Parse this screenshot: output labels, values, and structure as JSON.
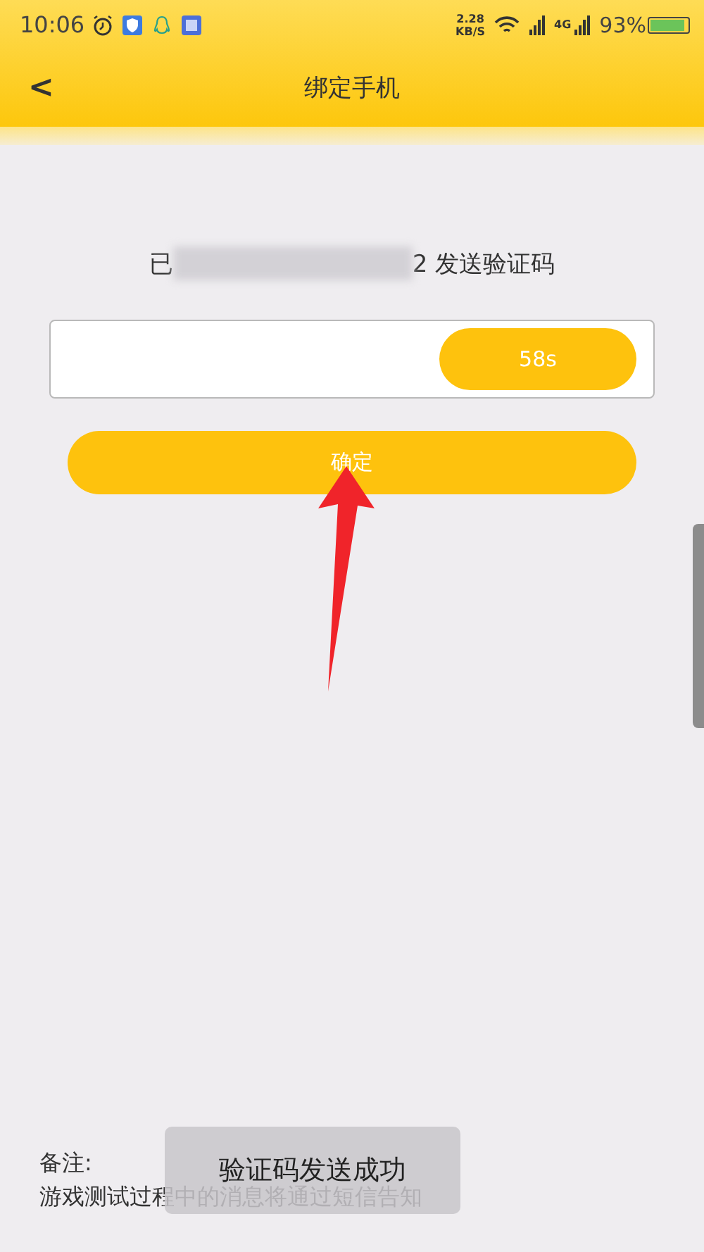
{
  "status_bar": {
    "time": "10:06",
    "speed": "2.28",
    "speed_unit": "KB/S",
    "network": "4G",
    "battery": "93%"
  },
  "header": {
    "back": "<",
    "title": "绑定手机"
  },
  "message": {
    "prefix": "已",
    "suffix": "2 发送验证码"
  },
  "code_field": {
    "countdown": "58s"
  },
  "confirm_button": "确定",
  "note": {
    "label": "备注:",
    "text": "游戏测试过程中的消息将通过短信告知"
  },
  "toast": "验证码发送成功"
}
